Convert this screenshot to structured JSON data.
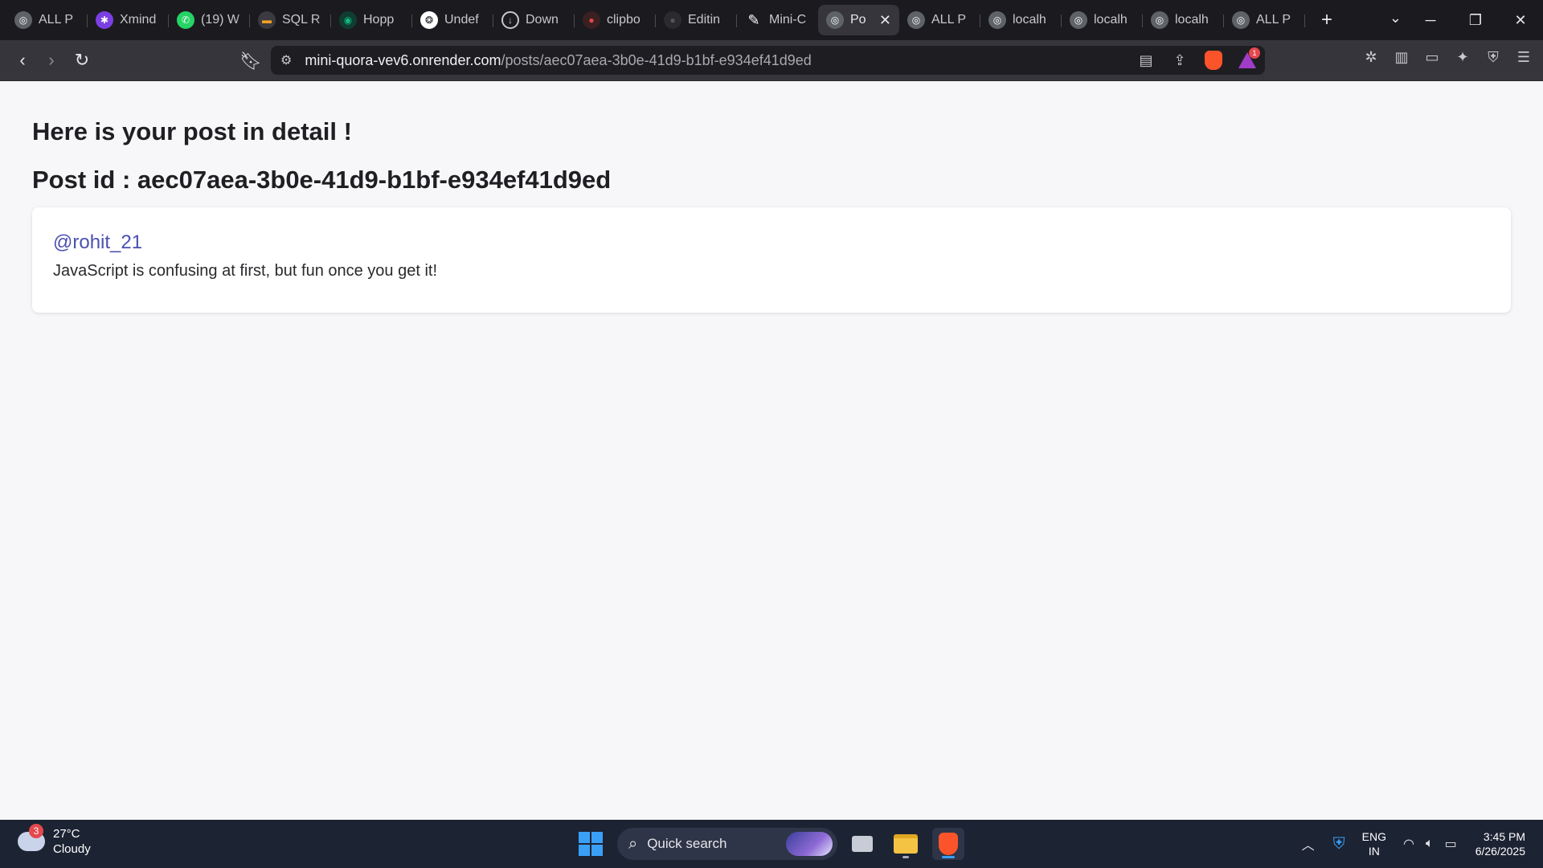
{
  "browser": {
    "tabs": [
      {
        "label": "ALL P",
        "icon": "globe-icon",
        "color": "#5f6368"
      },
      {
        "label": "Xmind",
        "icon": "xmind-icon",
        "color": "#7b3fe4"
      },
      {
        "label": "(19) W",
        "icon": "whatsapp-icon",
        "color": "#25d366"
      },
      {
        "label": "SQL R",
        "icon": "sql-icon",
        "color": "#f0a020"
      },
      {
        "label": "Hopp",
        "icon": "hoppscotch-icon",
        "color": "#10b981"
      },
      {
        "label": "Undef",
        "icon": "openai-icon",
        "color": "#ffffff"
      },
      {
        "label": "Down",
        "icon": "download-icon",
        "color": "#5f6368"
      },
      {
        "label": "clipbo",
        "icon": "record-icon",
        "color": "#e5484d"
      },
      {
        "label": "Editin",
        "icon": "github-icon",
        "color": "#2b2b2f"
      },
      {
        "label": "Mini-C",
        "icon": "render-icon",
        "color": "#ffffff"
      },
      {
        "label": "Po",
        "icon": "globe-icon",
        "color": "#5f6368",
        "active": true
      },
      {
        "label": "ALL P",
        "icon": "globe-icon",
        "color": "#5f6368"
      },
      {
        "label": "localh",
        "icon": "globe-icon",
        "color": "#5f6368"
      },
      {
        "label": "localh",
        "icon": "globe-icon",
        "color": "#5f6368"
      },
      {
        "label": "localh",
        "icon": "globe-icon",
        "color": "#5f6368"
      },
      {
        "label": "ALL P",
        "icon": "globe-icon",
        "color": "#5f6368"
      }
    ],
    "address": {
      "host": "mini-quora-vev6.onrender.com",
      "path": "/posts/aec07aea-3b0e-41d9-b1bf-e934ef41d9ed"
    },
    "rewards_badge": "1"
  },
  "page": {
    "heading": "Here is your post in detail !",
    "post_id_line": "Post id : aec07aea-3b0e-41d9-b1bf-e934ef41d9ed",
    "post": {
      "username": "@rohit_21",
      "content": "JavaScript is confusing at first, but fun once you get it!"
    }
  },
  "taskbar": {
    "weather": {
      "badge": "3",
      "temp": "27°C",
      "condition": "Cloudy"
    },
    "search_placeholder": "Quick search",
    "language": {
      "line1": "ENG",
      "line2": "IN"
    },
    "clock": {
      "time": "3:45 PM",
      "date": "6/26/2025"
    }
  },
  "colors": {
    "username": "#4b4fb0",
    "tabstrip_bg": "#1b1b1f",
    "toolbar_bg": "#35353b",
    "taskbar_bg": "#1c2333",
    "page_bg": "#f7f7f9"
  }
}
